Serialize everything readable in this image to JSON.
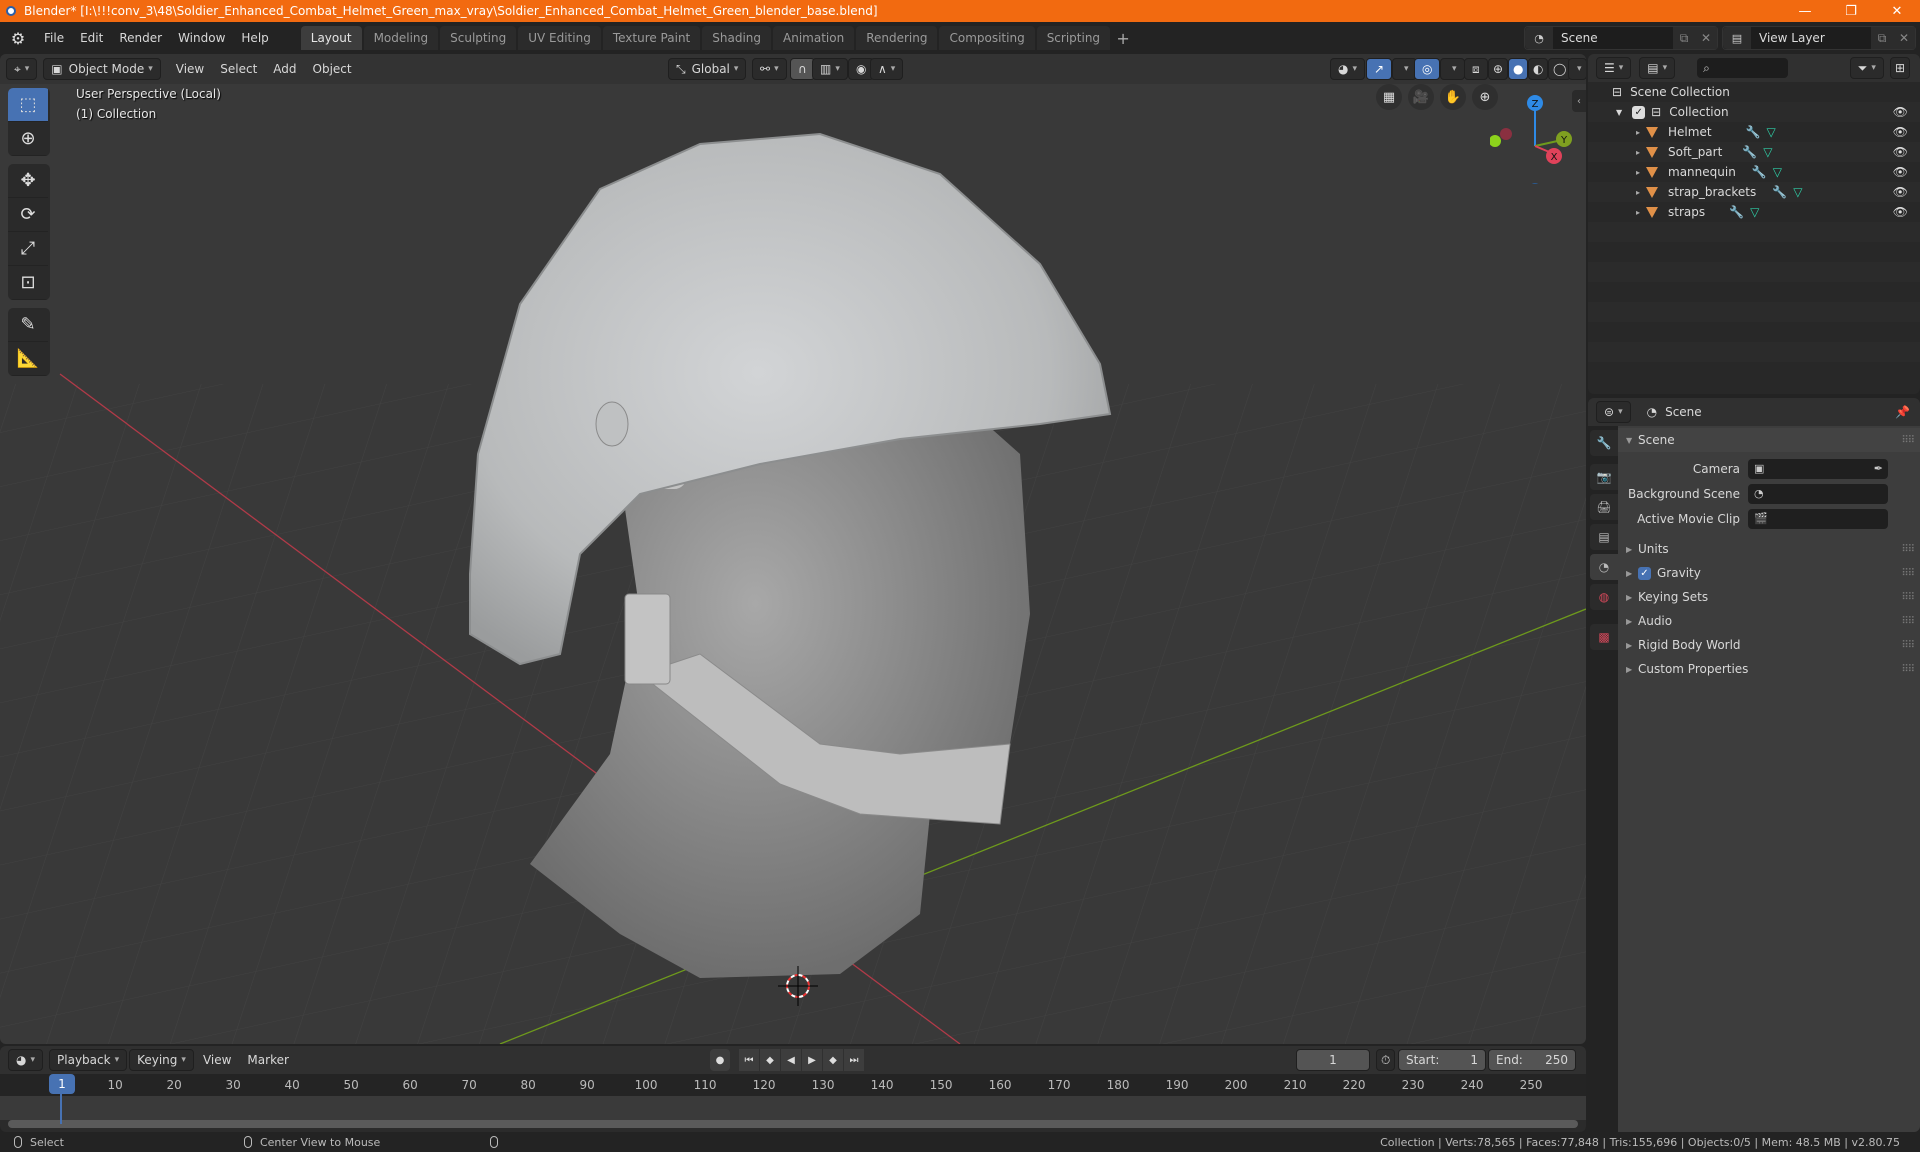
{
  "titlebar": {
    "title": "Blender* [I:\\!!!conv_3\\48\\Soldier_Enhanced_Combat_Helmet_Green_max_vray\\Soldier_Enhanced_Combat_Helmet_Green_blender_base.blend]",
    "minimize": "—",
    "maximize": "❐",
    "close": "✕"
  },
  "menu": [
    "File",
    "Edit",
    "Render",
    "Window",
    "Help"
  ],
  "workspaces": [
    {
      "label": "Layout",
      "active": true
    },
    {
      "label": "Modeling"
    },
    {
      "label": "Sculpting"
    },
    {
      "label": "UV Editing"
    },
    {
      "label": "Texture Paint"
    },
    {
      "label": "Shading"
    },
    {
      "label": "Animation"
    },
    {
      "label": "Rendering"
    },
    {
      "label": "Compositing"
    },
    {
      "label": "Scripting"
    }
  ],
  "workspace_add": "+",
  "scene_selector": {
    "value": "Scene"
  },
  "viewlayer_selector": {
    "value": "View Layer"
  },
  "viewport": {
    "mode": "Object Mode",
    "menus": [
      "View",
      "Select",
      "Add",
      "Object"
    ],
    "transform_orientation": "Global",
    "perspective_label": "User Perspective (Local)",
    "collection_label": "(1) Collection",
    "gizmo_axes": {
      "z": "Z",
      "y": "Y",
      "x": "X"
    },
    "colors": {
      "x_axis": "#c8424e",
      "y_axis": "#7fb01e",
      "z_axis": "#2e8ae6",
      "background": "#393939",
      "accent": "#4772b3"
    }
  },
  "outliner": {
    "search_placeholder": "",
    "scene_collection": "Scene Collection",
    "collection": "Collection",
    "objects": [
      {
        "name": "Helmet"
      },
      {
        "name": "Soft_part"
      },
      {
        "name": "mannequin"
      },
      {
        "name": "strap_brackets"
      },
      {
        "name": "straps"
      }
    ]
  },
  "properties": {
    "context": "Scene",
    "panel_title": "Scene",
    "fields": [
      {
        "label": "Camera",
        "value": ""
      },
      {
        "label": "Background Scene",
        "value": ""
      },
      {
        "label": "Active Movie Clip",
        "value": ""
      }
    ],
    "subpanels": [
      {
        "label": "Units"
      },
      {
        "label": "Gravity",
        "checkbox": true
      },
      {
        "label": "Keying Sets"
      },
      {
        "label": "Audio"
      },
      {
        "label": "Rigid Body World"
      },
      {
        "label": "Custom Properties"
      }
    ]
  },
  "timeline": {
    "menus": [
      "Playback",
      "Keying",
      "View",
      "Marker"
    ],
    "current_frame": "1",
    "start_label": "Start:",
    "start": "1",
    "end_label": "End:",
    "end": "250",
    "ticks": [
      "1",
      "10",
      "20",
      "30",
      "40",
      "50",
      "60",
      "70",
      "80",
      "90",
      "100",
      "110",
      "120",
      "130",
      "140",
      "150",
      "160",
      "170",
      "180",
      "190",
      "200",
      "210",
      "220",
      "230",
      "240",
      "250"
    ]
  },
  "statusbar": {
    "left": "Select",
    "middle": "Center View to Mouse",
    "stats": "Collection | Verts:78,565 | Faces:77,848 | Tris:155,696 | Objects:0/5 | Mem: 48.5 MB | v2.80.75"
  }
}
